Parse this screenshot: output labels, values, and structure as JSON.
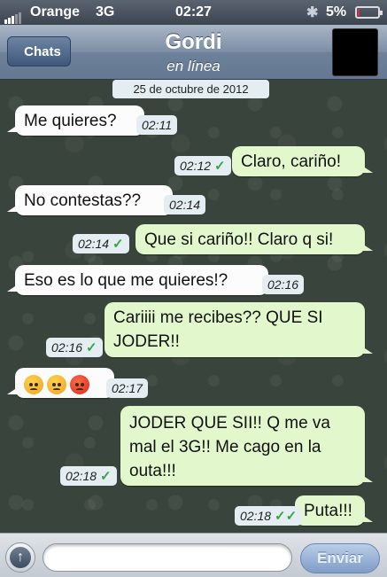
{
  "status_bar": {
    "carrier": "Orange",
    "network": "3G",
    "time": "02:27",
    "battery_percent_label": "5%",
    "battery_level": 0.05,
    "bluetooth_icon": "bluetooth-icon",
    "low_battery_color": "#e03030"
  },
  "nav": {
    "back_label": "Chats",
    "contact_name": "Gordi",
    "contact_status": "en línea"
  },
  "chat": {
    "date": "25 de octubre de 2012",
    "messages": [
      {
        "dir": "in",
        "text": "Me quieres?",
        "time": "02:11"
      },
      {
        "dir": "out",
        "text": "Claro, cariño!",
        "time": "02:12",
        "status": "sent"
      },
      {
        "dir": "in",
        "text": "No contestas??",
        "time": "02:14"
      },
      {
        "dir": "out",
        "text": "Que si cariño!! Claro q si!",
        "time": "02:14",
        "status": "sent"
      },
      {
        "dir": "in",
        "text": "Eso es lo que me quieres!?",
        "time": "02:16"
      },
      {
        "dir": "out",
        "text_lines": [
          "Cariiii me recibes?? QUE SI",
          "JODER!!"
        ],
        "time": "02:16",
        "status": "sent"
      },
      {
        "dir": "in",
        "emojis": [
          "angry-face-icon",
          "angry-face-icon",
          "red-angry-face-icon"
        ],
        "time": "02:17"
      },
      {
        "dir": "out",
        "text_lines": [
          "JODER QUE SII!! Q me va",
          "mal el 3G!! Me cago en la",
          "outa!!!"
        ],
        "time": "02:18",
        "status": "sent"
      },
      {
        "dir": "out",
        "text": "Puta!!!",
        "time": "02:18",
        "status": "delivered"
      }
    ]
  },
  "input_bar": {
    "placeholder": "",
    "send_label": "Enviar"
  },
  "colors": {
    "incoming_bubble": "#fcfcfc",
    "outgoing_bubble": "#e2f7cb",
    "check_mark": "#3aa348"
  }
}
